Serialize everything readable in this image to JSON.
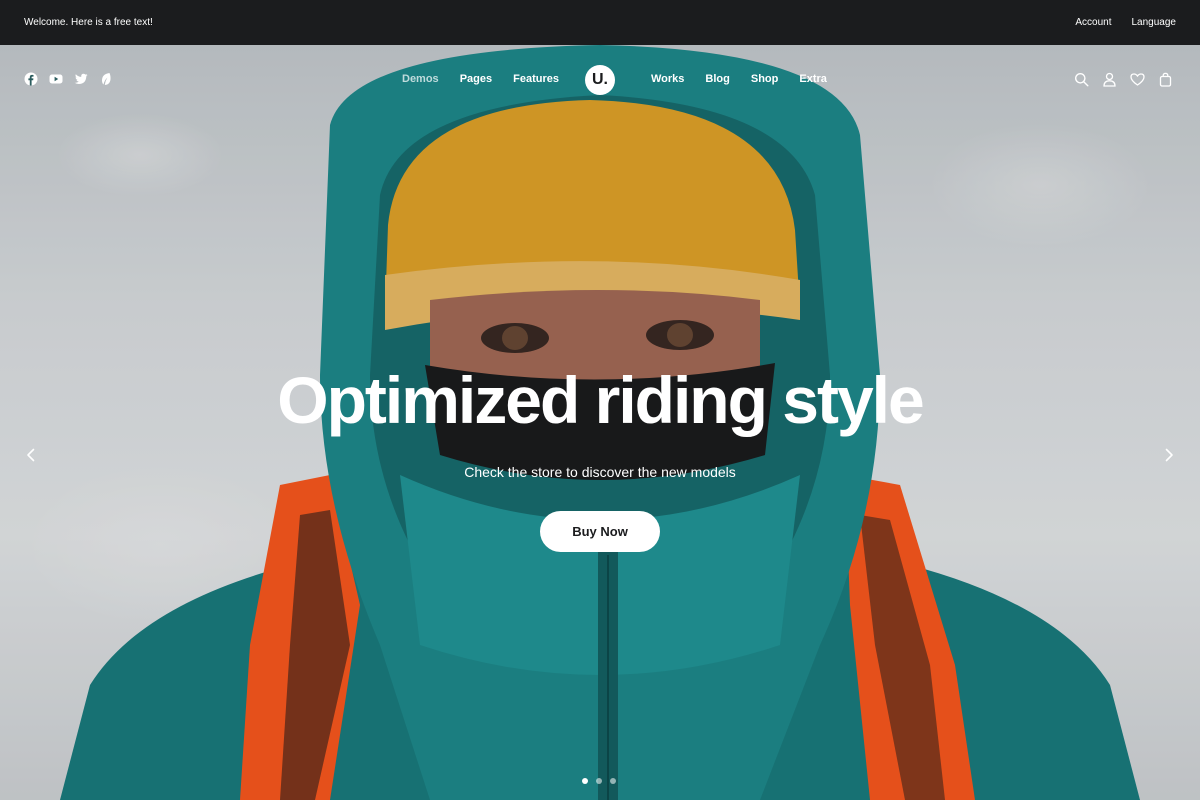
{
  "topbar": {
    "welcome": "Welcome. Here is a free text!",
    "links": [
      "Account",
      "Language"
    ]
  },
  "nav": {
    "social_icons": [
      "facebook-icon",
      "youtube-icon",
      "twitter-icon",
      "leaf-icon"
    ],
    "left_items": [
      "Demos",
      "Pages",
      "Features"
    ],
    "logo": "U.",
    "right_items": [
      "Works",
      "Blog",
      "Shop",
      "Extra"
    ],
    "tool_icons": [
      "search-icon",
      "user-icon",
      "heart-icon",
      "bag-icon"
    ]
  },
  "hero": {
    "title": "Optimized riding style",
    "subtitle": "Check the store to discover the new models",
    "cta_label": "Buy Now",
    "slide_count": 3,
    "active_slide": 1
  },
  "colors": {
    "topbar_bg": "#1b1c1e",
    "jacket": "#1f8d8f",
    "beanie": "#e6a62a",
    "straps": "#ff5a1f",
    "text": "#ffffff"
  }
}
